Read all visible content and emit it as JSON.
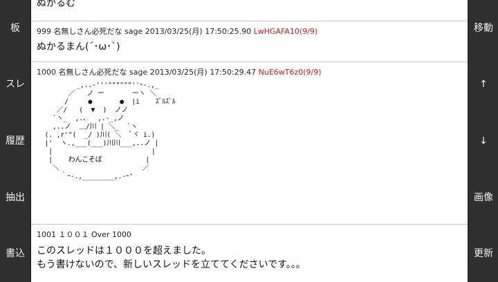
{
  "left_nav": [
    "板",
    "スレ",
    "履歴",
    "抽出",
    "書込"
  ],
  "right_nav": [
    "移動",
    "↑",
    "↓",
    "画像",
    "更新"
  ],
  "posts": [
    {
      "body": "ぬかるむ"
    },
    {
      "number": "999",
      "name": "名無しさん必死だな",
      "mail": "sage",
      "date": "2013/03/25(月) 17:50:25.90",
      "id": "LwHGAFA10(9/9)",
      "body": "ぬかるまん(´･ω･`)"
    },
    {
      "number": "1000",
      "name": "名無しさん必死だな",
      "mail": "sage",
      "date": "2013/03/25(月) 17:50:29.47",
      "id": "NuE6wT6z0(9/9)",
      "aa": "          _,..-'''\"\"\"\"\"\"''ｰ-.,_\n        ／   ノ ー       ーヽ ＼\n       /     ●       ●  |i    ｽﾞﾙｽﾞﾙ\n     ／/   (  ▼  )  ノノ\n    `ヽ_  ,.、  ,.-_,ノ\n    ,..ノ  ＿/川 | ＼_  `ヽ\n  (. ,r'\"(  _/ )川( ＼  ﾞヾ i.)\n  |'  ヽ.,___(___)川川___,..ノ |\n   |                         |\n   |    わんこそば           |\n    ＼                     ／\n      ｀ｰ-.,________,.-ｰ'"
    },
    {
      "header": "1001 １００１ Over 1000",
      "body": "このスレッドは１０００を超えました。\nもう書けないので、新しいスレッドを立ててくださいです。。。"
    }
  ]
}
